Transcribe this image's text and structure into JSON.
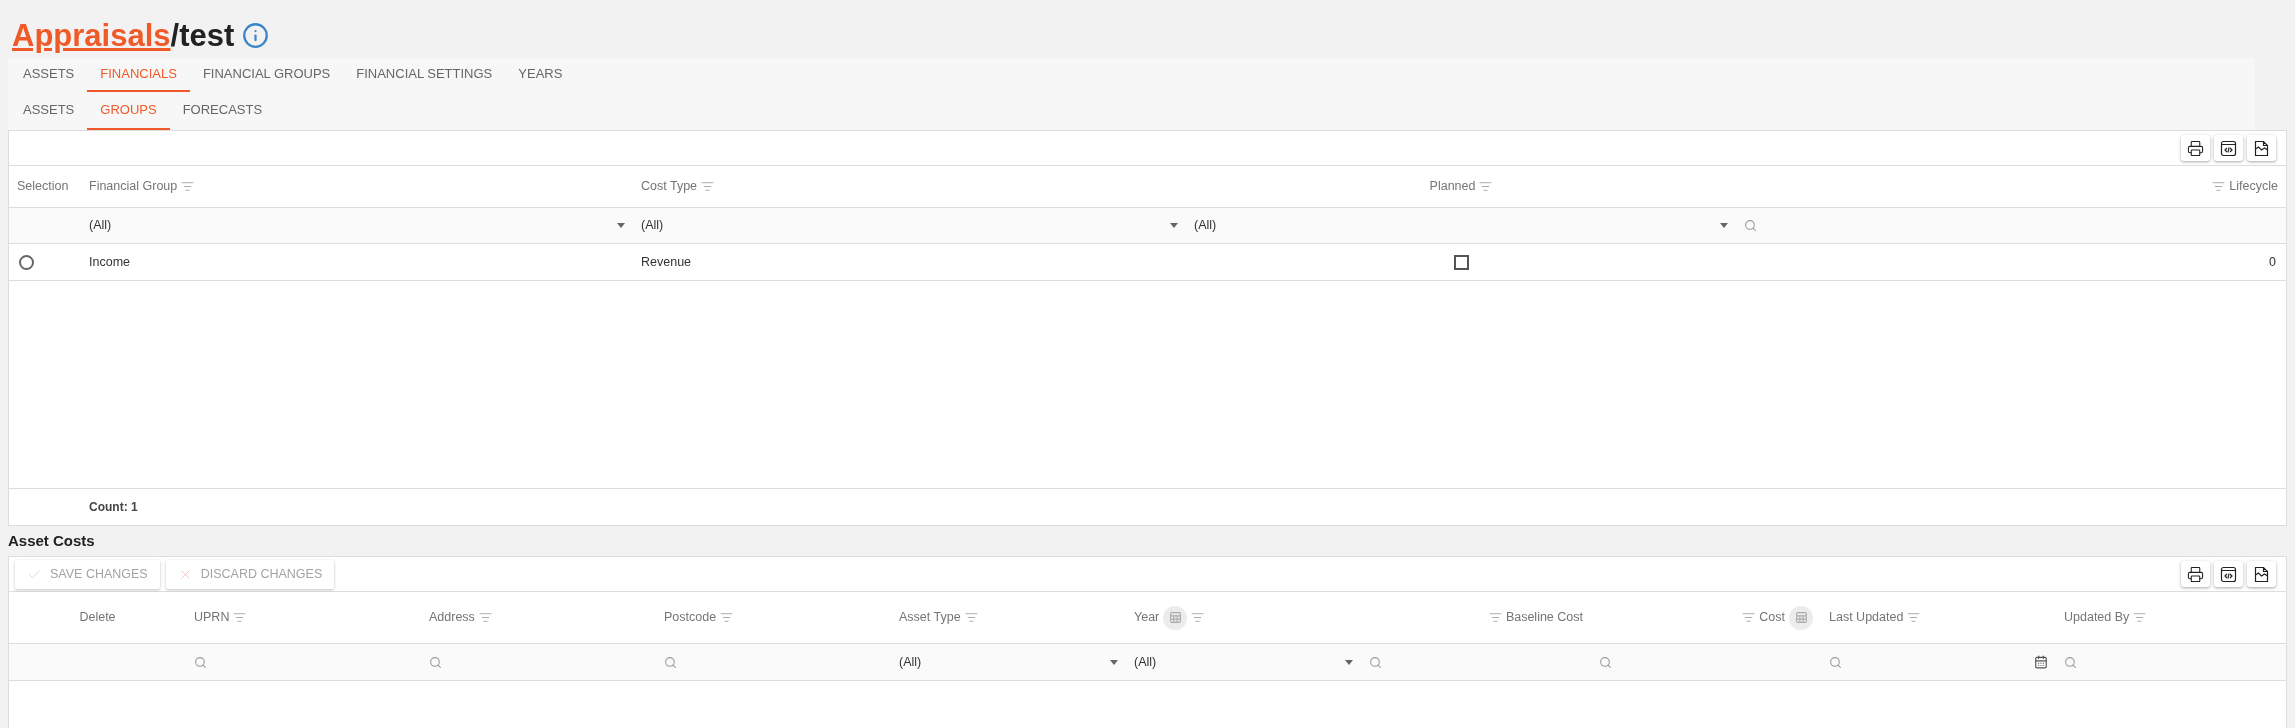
{
  "breadcrumb": {
    "link": "Appraisals",
    "current": "/test"
  },
  "tabs": [
    {
      "label": "ASSETS",
      "selected": false
    },
    {
      "label": "FINANCIALS",
      "selected": true
    },
    {
      "label": "FINANCIAL GROUPS",
      "selected": false
    },
    {
      "label": "FINANCIAL SETTINGS",
      "selected": false
    },
    {
      "label": "YEARS",
      "selected": false
    }
  ],
  "subtabs": [
    {
      "label": "ASSETS",
      "selected": false
    },
    {
      "label": "GROUPS",
      "selected": true
    },
    {
      "label": "FORECASTS",
      "selected": false
    }
  ],
  "groups_grid": {
    "columns": [
      {
        "label": "Selection",
        "kind": "text",
        "filterable": false
      },
      {
        "label": "Financial Group",
        "kind": "text",
        "filterable": true
      },
      {
        "label": "Cost Type",
        "kind": "text",
        "filterable": true
      },
      {
        "label": "Planned",
        "kind": "boolean",
        "filterable": true
      },
      {
        "label": "Lifecycle",
        "kind": "number",
        "filterable": true
      }
    ],
    "filters": [
      {
        "kind": "none"
      },
      {
        "kind": "dropdown",
        "value": "(All)"
      },
      {
        "kind": "dropdown",
        "value": "(All)"
      },
      {
        "kind": "dropdown",
        "value": "(All)"
      },
      {
        "kind": "search"
      }
    ],
    "rows": [
      {
        "selected": false,
        "financial_group": "Income",
        "cost_type": "Revenue",
        "planned": false,
        "lifecycle": "0"
      }
    ],
    "footer": "Count: 1"
  },
  "asset_costs": {
    "title": "Asset Costs",
    "buttons": [
      {
        "label": "SAVE CHANGES",
        "kind": "save",
        "disabled": true
      },
      {
        "label": "DISCARD CHANGES",
        "kind": "discard",
        "disabled": true
      }
    ],
    "columns": [
      {
        "label": "Delete",
        "kind": "center",
        "filterable": false,
        "chooser": false
      },
      {
        "label": "UPRN",
        "kind": "text",
        "filterable": true,
        "chooser": false
      },
      {
        "label": "Address",
        "kind": "text",
        "filterable": true,
        "chooser": false
      },
      {
        "label": "Postcode",
        "kind": "text",
        "filterable": true,
        "chooser": false
      },
      {
        "label": "Asset Type",
        "kind": "text",
        "filterable": true,
        "chooser": false
      },
      {
        "label": "Year",
        "kind": "text",
        "filterable": true,
        "chooser": true
      },
      {
        "label": "Baseline Cost",
        "kind": "number",
        "filterable": true,
        "chooser": false
      },
      {
        "label": "Cost",
        "kind": "number",
        "filterable": true,
        "chooser": true
      },
      {
        "label": "Last Updated",
        "kind": "text",
        "filterable": true,
        "chooser": false
      },
      {
        "label": "Updated By",
        "kind": "text",
        "filterable": true,
        "chooser": false
      }
    ],
    "filters": [
      {
        "kind": "none"
      },
      {
        "kind": "search"
      },
      {
        "kind": "search"
      },
      {
        "kind": "search"
      },
      {
        "kind": "dropdown",
        "value": "(All)"
      },
      {
        "kind": "dropdown",
        "value": "(All)"
      },
      {
        "kind": "search"
      },
      {
        "kind": "search"
      },
      {
        "kind": "date"
      },
      {
        "kind": "search"
      }
    ]
  }
}
